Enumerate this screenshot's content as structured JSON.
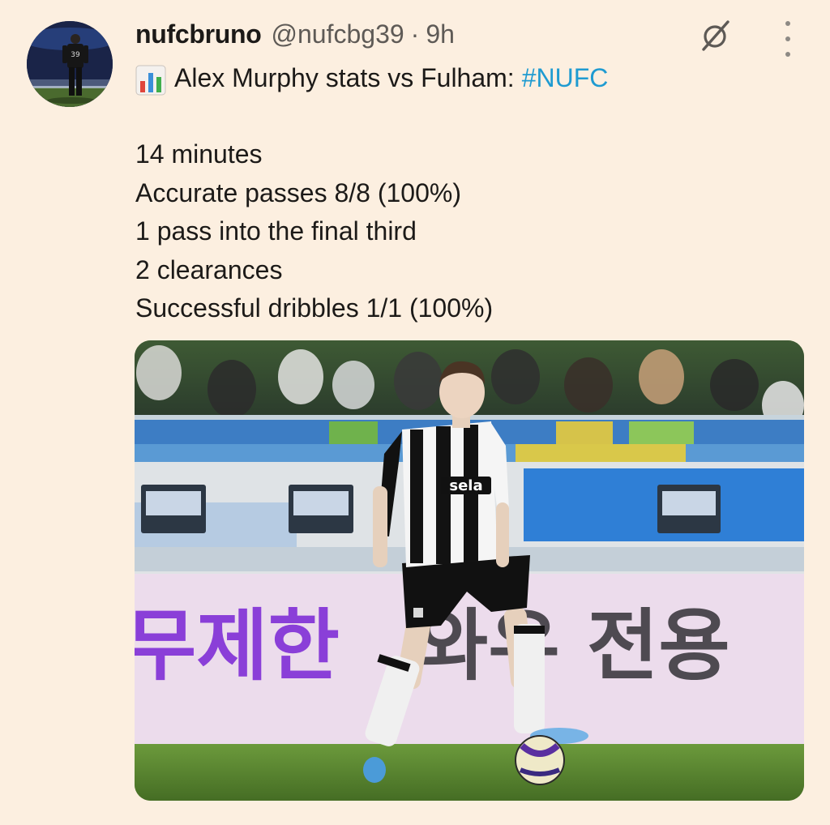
{
  "author": {
    "display_name": "nufcbruno",
    "handle": "@nufcbg39",
    "separator": "·",
    "time": "9h",
    "avatar_icon": "player-back-number-avatar"
  },
  "actions": {
    "grok_icon": "grok-slash-circle-icon",
    "more_icon": "vertical-dots-icon"
  },
  "post": {
    "emoji_icon": "bar-chart-emoji",
    "headline": "Alex Murphy stats vs Fulham:",
    "hashtag": "#NUFC",
    "stats": [
      "14 minutes",
      "Accurate passes 8/8 (100%)",
      "1 pass into the final third",
      "2 clearances",
      "Successful dribbles 1/1 (100%)"
    ]
  },
  "media": {
    "description_icon": "football-player-photo",
    "shirt_sponsor": "sela",
    "board_text_purple": "무제한",
    "board_text_dark": "와우 전용"
  },
  "colors": {
    "background": "#fcefe0",
    "link": "#1f9bd1",
    "muted_text": "#5e5a56",
    "board_purple": "#8a3fd8"
  }
}
